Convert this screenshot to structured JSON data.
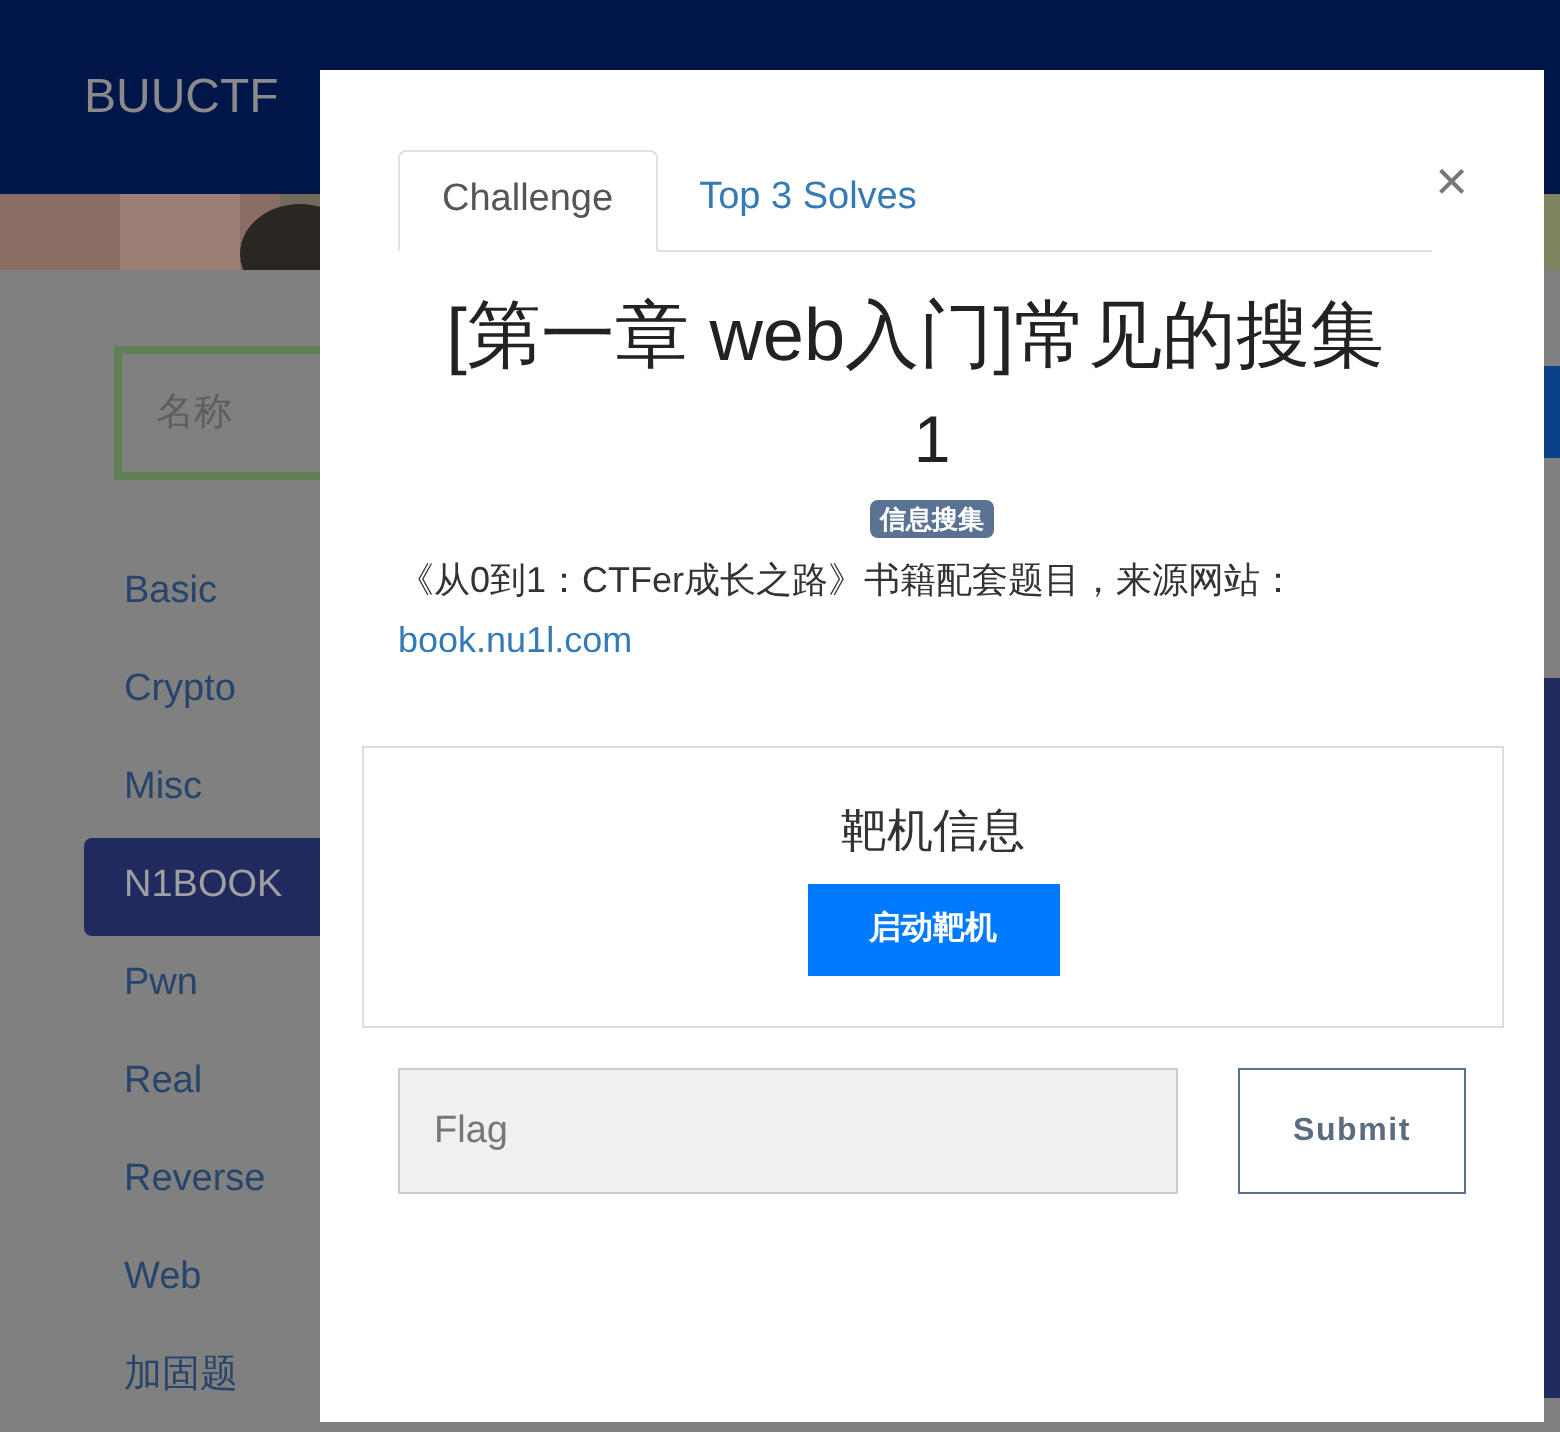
{
  "navbar": {
    "brand": "BUUCTF"
  },
  "sidebar": {
    "search": {
      "placeholder": "名称"
    },
    "categories": [
      {
        "label": "Basic",
        "selected": false
      },
      {
        "label": "Crypto",
        "selected": false
      },
      {
        "label": "Misc",
        "selected": false
      },
      {
        "label": "N1BOOK",
        "selected": true
      },
      {
        "label": "Pwn",
        "selected": false
      },
      {
        "label": "Real",
        "selected": false
      },
      {
        "label": "Reverse",
        "selected": false
      },
      {
        "label": "Web",
        "selected": false
      },
      {
        "label": "加固题",
        "selected": false
      }
    ]
  },
  "modal": {
    "tabs": [
      {
        "label": "Challenge",
        "selected": true
      },
      {
        "label": "Top 3 Solves",
        "selected": false
      }
    ],
    "close": "×",
    "title": "[第一章 web入门]常见的搜集",
    "value": "1",
    "tag": "信息搜集",
    "description": "《从0到1：CTFer成长之路》书籍配套题目，来源网站：",
    "link": "book.nu1l.com",
    "target": {
      "heading": "靶机信息",
      "button": "启动靶机"
    },
    "flag": {
      "placeholder": "Flag"
    },
    "submit": "Submit"
  }
}
